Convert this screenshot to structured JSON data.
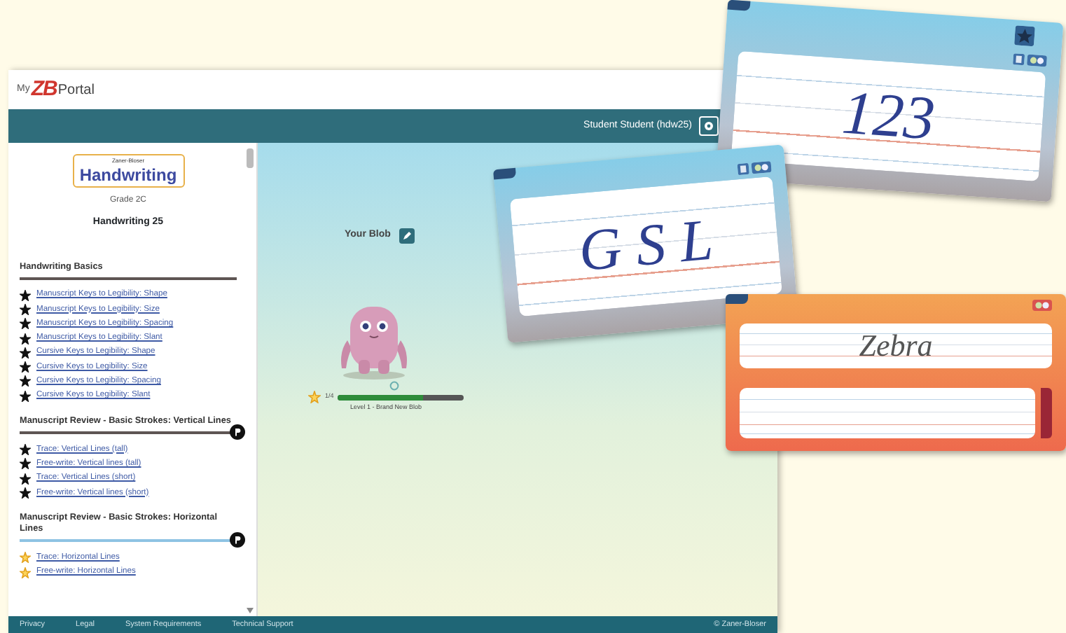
{
  "header": {
    "logo": {
      "prefix": "My",
      "mark": "ZB",
      "name": "Portal"
    },
    "user": "Student Student (hdw25)"
  },
  "sidebar": {
    "brand": {
      "maker": "Zaner-Bloser",
      "product": "Handwriting"
    },
    "grade": "Grade 2C",
    "course": "Handwriting 25",
    "sections": [
      {
        "title": "Handwriting Basics",
        "complete": true,
        "badge": false,
        "items": [
          {
            "label": "Manuscript Keys to Legibility: Shape",
            "complete": true
          },
          {
            "label": "Manuscript Keys to Legibility: Size",
            "complete": true
          },
          {
            "label": "Manuscript Keys to Legibility: Spacing",
            "complete": true
          },
          {
            "label": "Manuscript Keys to Legibility: Slant",
            "complete": true
          },
          {
            "label": "Cursive Keys to Legibility: Shape",
            "complete": true
          },
          {
            "label": "Cursive Keys to Legibility: Size",
            "complete": true
          },
          {
            "label": "Cursive Keys to Legibility: Spacing",
            "complete": true
          },
          {
            "label": "Cursive Keys to Legibility: Slant",
            "complete": true
          }
        ]
      },
      {
        "title": "Manuscript Review - Basic Strokes: Vertical Lines",
        "complete": true,
        "badge": true,
        "items": [
          {
            "label": "Trace: Vertical Lines (tall)",
            "complete": true
          },
          {
            "label": "Free-write: Vertical lines (tall)",
            "complete": true
          },
          {
            "label": "Trace: Vertical Lines (short)",
            "complete": true
          },
          {
            "label": "Free-write: Vertical lines (short)",
            "complete": true
          }
        ]
      },
      {
        "title": "Manuscript Review - Basic Strokes: Horizontal Lines",
        "complete": false,
        "badge": true,
        "items": [
          {
            "label": "Trace: Horizontal Lines",
            "complete": false
          },
          {
            "label": "Free-write: Horizontal Lines",
            "complete": false
          }
        ]
      }
    ]
  },
  "blob": {
    "title": "Your Blob",
    "reading": "1/4",
    "level": 0.68,
    "caption": "Level 1 - Brand New Blob"
  },
  "cards": [
    {
      "text": "123",
      "kind": "trace",
      "star_button": true
    },
    {
      "text": "G S L",
      "kind": "trace",
      "star_button": false
    },
    {
      "text": "Zebra",
      "kind": "copy",
      "star_button": false
    }
  ],
  "footer": {
    "links": [
      "Privacy",
      "Legal",
      "System Requirements",
      "Technical Support"
    ],
    "copyright": "© Zaner-Bloser"
  }
}
